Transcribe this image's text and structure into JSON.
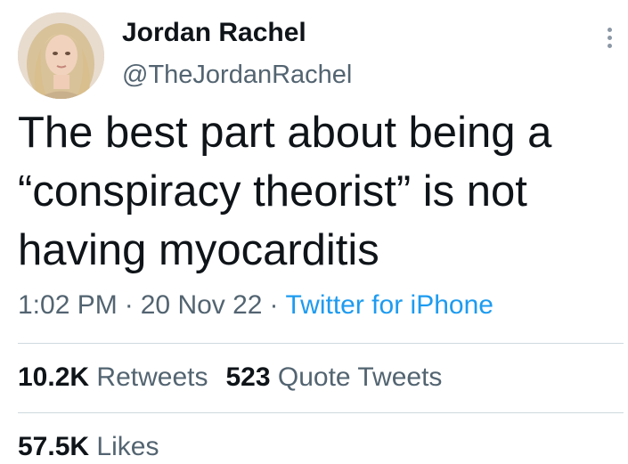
{
  "author": {
    "name": "Jordan Rachel",
    "handle": "@TheJordanRachel",
    "avatar_icon": "profile-photo"
  },
  "more_icon": "ellipsis-vertical-icon",
  "tweet": {
    "text": "The best part about being a\n“conspiracy theorist” is not\nhaving myocarditis",
    "time": "1:02 PM",
    "date": "20 Nov 22",
    "separator": "·",
    "source": "Twitter for iPhone"
  },
  "stats": {
    "retweets": {
      "count": "10.2K",
      "label": "Retweets"
    },
    "quote_tweets": {
      "count": "523",
      "label": "Quote Tweets"
    },
    "likes": {
      "count": "57.5K",
      "label": "Likes"
    }
  },
  "colors": {
    "text": "#0f1419",
    "secondary": "#536471",
    "link": "#1d9bf0",
    "divider": "#cfd9de"
  }
}
